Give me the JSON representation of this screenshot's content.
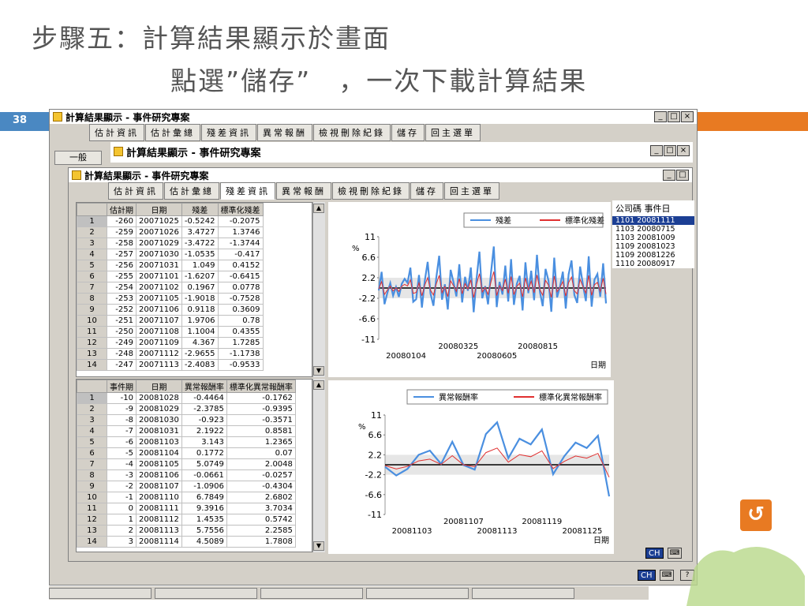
{
  "slide": {
    "title_line1": "步驟五：計算結果顯示於畫面",
    "title_line2": "點選”儲存”　，一次下載計算結果",
    "slide_number": "38"
  },
  "window_outer": {
    "title": "計算結果顯示 - 事件研究專案",
    "menus": [
      "估計資訊",
      "估計彙總",
      "殘差資訊",
      "異常報酬",
      "檢視刪除紀錄",
      "儲存",
      "回主選單"
    ],
    "tab_left": "一般"
  },
  "window_middle": {
    "title": "計算結果顯示 - 事件研究專案"
  },
  "window_inner": {
    "title": "計算結果顯示 - 事件研究專案",
    "menus": [
      "估計資訊",
      "估計彙總",
      "殘差資訊",
      "異常報酬",
      "檢視刪除紀錄",
      "儲存",
      "回主選單"
    ],
    "active_menu": "殘差資訊"
  },
  "table_top": {
    "headers": [
      "",
      "估計期",
      "日期",
      "殘差",
      "標準化殘差"
    ],
    "rows": [
      [
        "1",
        "-260",
        "20071025",
        "-0.5242",
        "-0.2075"
      ],
      [
        "2",
        "-259",
        "20071026",
        "3.4727",
        "1.3746"
      ],
      [
        "3",
        "-258",
        "20071029",
        "-3.4722",
        "-1.3744"
      ],
      [
        "4",
        "-257",
        "20071030",
        "-1.0535",
        "-0.417"
      ],
      [
        "5",
        "-256",
        "20071031",
        "1.049",
        "0.4152"
      ],
      [
        "6",
        "-255",
        "20071101",
        "-1.6207",
        "-0.6415"
      ],
      [
        "7",
        "-254",
        "20071102",
        "0.1967",
        "0.0778"
      ],
      [
        "8",
        "-253",
        "20071105",
        "-1.9018",
        "-0.7528"
      ],
      [
        "9",
        "-252",
        "20071106",
        "0.9118",
        "0.3609"
      ],
      [
        "10",
        "-251",
        "20071107",
        "1.9706",
        "0.78"
      ],
      [
        "11",
        "-250",
        "20071108",
        "1.1004",
        "0.4355"
      ],
      [
        "12",
        "-249",
        "20071109",
        "4.367",
        "1.7285"
      ],
      [
        "13",
        "-248",
        "20071112",
        "-2.9655",
        "-1.1738"
      ],
      [
        "14",
        "-247",
        "20071113",
        "-2.4083",
        "-0.9533"
      ]
    ]
  },
  "table_bottom": {
    "headers": [
      "",
      "事件期",
      "日期",
      "異常報酬率",
      "標準化異常報酬率"
    ],
    "rows": [
      [
        "1",
        "-10",
        "20081028",
        "-0.4464",
        "-0.1762"
      ],
      [
        "2",
        "-9",
        "20081029",
        "-2.3785",
        "-0.9395"
      ],
      [
        "3",
        "-8",
        "20081030",
        "-0.923",
        "-0.3571"
      ],
      [
        "4",
        "-7",
        "20081031",
        "2.1922",
        "0.8581"
      ],
      [
        "5",
        "-6",
        "20081103",
        "3.143",
        "1.2365"
      ],
      [
        "6",
        "-5",
        "20081104",
        "0.1772",
        "0.07"
      ],
      [
        "7",
        "-4",
        "20081105",
        "5.0749",
        "2.0048"
      ],
      [
        "8",
        "-3",
        "20081106",
        "-0.0661",
        "-0.0257"
      ],
      [
        "9",
        "-2",
        "20081107",
        "-1.0906",
        "-0.4304"
      ],
      [
        "10",
        "-1",
        "20081110",
        "6.7849",
        "2.6802"
      ],
      [
        "11",
        "0",
        "20081111",
        "9.3916",
        "3.7034"
      ],
      [
        "12",
        "1",
        "20081112",
        "1.4535",
        "0.5742"
      ],
      [
        "13",
        "2",
        "20081113",
        "5.7556",
        "2.2585"
      ],
      [
        "14",
        "3",
        "20081114",
        "4.5089",
        "1.7808"
      ]
    ]
  },
  "company_list": {
    "header": "公司碼 事件日",
    "items": [
      "1101 20081111",
      "1103 20080715",
      "1103 20081009",
      "1109 20081023",
      "1109 20081226",
      "1110 20080917"
    ]
  },
  "chart_top": {
    "legend": [
      "殘差",
      "標準化殘差"
    ],
    "percent_label": "%",
    "yticks": [
      "11",
      "6.6",
      "2.2",
      "-2.2",
      "-6.6",
      "-11"
    ],
    "xticks_upper": [
      "20080325",
      "20080815"
    ],
    "xticks_lower": [
      "20080104",
      "20080605"
    ],
    "xlabel": "日期"
  },
  "chart_bottom": {
    "legend": [
      "異常報酬率",
      "標準化異常報酬率"
    ],
    "percent_label": "%",
    "yticks": [
      "11",
      "6.6",
      "2.2",
      "-2.2",
      "-6.6",
      "-11"
    ],
    "xticks_upper": [
      "20081107",
      "20081119"
    ],
    "xticks_lower": [
      "20081103",
      "20081113",
      "20081125"
    ],
    "xlabel": "日期"
  },
  "chart_data": [
    {
      "type": "line",
      "series": [
        {
          "name": "殘差",
          "values": [
            -0.52,
            3.47,
            -3.47,
            -1.05,
            1.05,
            -1.62,
            0.2,
            -1.9,
            0.91,
            1.97,
            1.1,
            4.37,
            -2.97,
            -2.41,
            2.8,
            -4.2,
            1.5,
            5.6,
            -1.2,
            -3.8,
            2.2,
            6.9,
            -2.5,
            0.8,
            -4.6,
            3.9,
            1.2,
            -1.8,
            5.1,
            -3.1,
            2.4,
            -0.6,
            4.4,
            -5.2,
            1.9,
            7.8,
            -2.2,
            0.4,
            -3.5,
            3.2,
            8.9,
            -4.1,
            1.3,
            -1.4,
            4.8,
            -2.9,
            6.2,
            -3.6,
            0.9,
            2.6,
            -4.8,
            5.5,
            -1.1,
            3.7,
            -2.6,
            7.1,
            -0.8,
            -3.9,
            4.1,
            1.6,
            -5.1,
            6.5,
            -2.0,
            0.3,
            3.5,
            -4.4,
            2.9,
            5.9,
            -1.5,
            -3.2,
            4.6,
            0.7,
            -2.8,
            6.8,
            -4.0,
            1.8,
            3.0,
            -1.9,
            5.3,
            -3.3
          ]
        },
        {
          "name": "標準化殘差",
          "values": [
            -0.21,
            1.37,
            -1.37,
            -0.42,
            0.42,
            -0.64,
            0.08,
            -0.75,
            0.36,
            0.78,
            0.44,
            1.73,
            -1.17,
            -0.95,
            1.1,
            -1.66,
            0.6,
            2.2,
            -0.48,
            -1.5,
            0.87,
            2.7,
            -0.99,
            0.32,
            -1.82,
            1.54,
            0.47,
            -0.71,
            2.0,
            -1.23,
            0.95,
            -0.24,
            1.74,
            -2.06,
            0.75,
            3.08,
            -0.87,
            0.16,
            -1.38,
            1.27,
            3.52,
            -1.62,
            0.51,
            -0.55,
            1.9,
            -1.15,
            2.45,
            -1.42,
            0.36,
            1.03,
            -1.9,
            2.17,
            -0.43,
            1.46,
            -1.03,
            2.8,
            -0.32,
            -1.54,
            1.62,
            0.63,
            -2.02,
            2.57,
            -0.79,
            0.12,
            1.38,
            -1.74,
            1.15,
            2.33,
            -0.59,
            -1.26,
            1.82,
            0.28,
            -1.1,
            2.69,
            -1.58,
            0.71,
            1.19,
            -0.75,
            2.09,
            -1.3
          ]
        }
      ],
      "ylim": [
        -11,
        11
      ],
      "xlabel": "日期",
      "grid": false,
      "legend_position": "top-right"
    },
    {
      "type": "line",
      "categories": [
        "20081028",
        "20081029",
        "20081030",
        "20081031",
        "20081103",
        "20081104",
        "20081105",
        "20081106",
        "20081107",
        "20081110",
        "20081111",
        "20081112",
        "20081113",
        "20081114",
        "20081117",
        "20081118",
        "20081119",
        "20081120",
        "20081121",
        "20081124",
        "20081125"
      ],
      "series": [
        {
          "name": "異常報酬率",
          "values": [
            -0.4464,
            -2.3785,
            -0.923,
            2.1922,
            3.143,
            0.1772,
            5.0749,
            -0.0661,
            -1.0906,
            6.7849,
            9.3916,
            1.4535,
            5.7556,
            4.5089,
            7.8,
            -2.1,
            1.9,
            4.9,
            3.7,
            6.4,
            -7.0
          ]
        },
        {
          "name": "標準化異常報酬率",
          "values": [
            -0.1762,
            -0.9395,
            -0.3571,
            0.8581,
            1.2365,
            0.07,
            2.0048,
            -0.0257,
            -0.4304,
            2.6802,
            3.7034,
            0.5742,
            2.2585,
            1.7808,
            3.08,
            -0.83,
            0.75,
            1.94,
            1.46,
            2.52,
            -2.76
          ]
        }
      ],
      "ylim": [
        -11,
        11
      ],
      "xlabel": "日期",
      "grid": false,
      "legend_position": "top"
    }
  ],
  "colors": {
    "series_primary": "#4a8fe0",
    "series_secondary": "#e03030",
    "accent_orange": "#e87a22",
    "accent_blue": "#4a88c2"
  },
  "status": {
    "ch_label": "CH"
  }
}
